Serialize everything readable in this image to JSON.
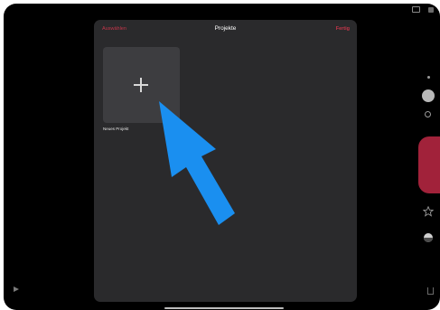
{
  "projects_panel": {
    "select_label": "Auswählen",
    "title": "Projekte",
    "done_label": "Fertig",
    "new_project": {
      "label": "Neues Projekt",
      "icon": "plus-icon"
    }
  },
  "camera_controls": {
    "icons": [
      "display-mode-icon",
      "camera-switch-icon",
      "mode-dot-icon",
      "mode-knob-icon",
      "mode-ring-icon",
      "record-button",
      "star-icon",
      "media-browser-icon",
      "share-icon"
    ]
  },
  "playback": {
    "icon": "play-icon"
  },
  "annotation": {
    "arrow_color": "#1a8ff0",
    "points_to": "new-project-tile"
  },
  "colors": {
    "accent": "#c4364a",
    "record": "#a1223a",
    "panel": "#2a2a2c",
    "tile": "#3d3d40"
  }
}
